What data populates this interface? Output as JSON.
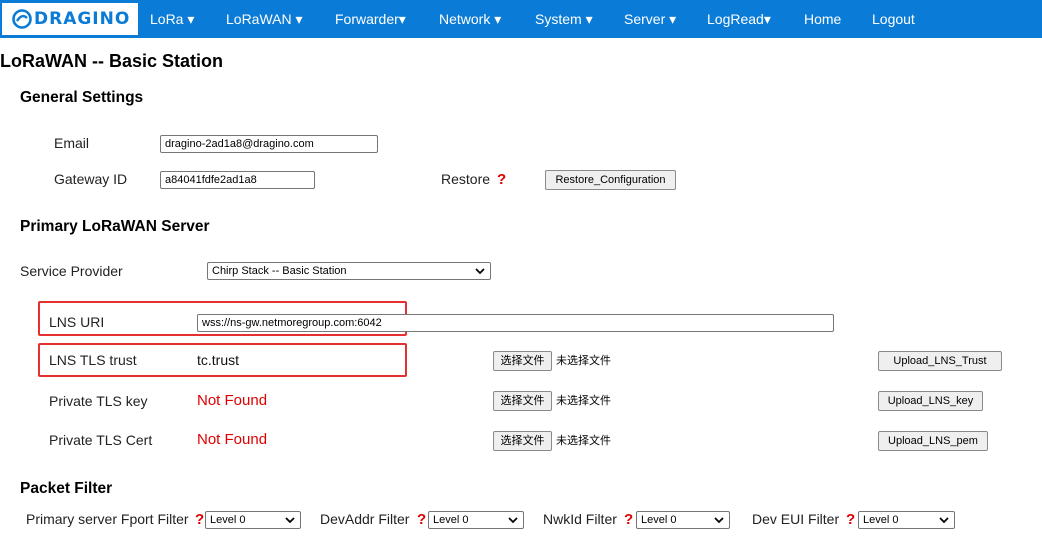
{
  "nav": {
    "brand": "DRAGINO",
    "items": [
      {
        "label": "LoRa",
        "caret": "▾"
      },
      {
        "label": "LoRaWAN",
        "caret": "▾"
      },
      {
        "label": "Forwarder",
        "caret": "▾"
      },
      {
        "label": "Network",
        "caret": "▾"
      },
      {
        "label": "System",
        "caret": "▾"
      },
      {
        "label": "Server",
        "caret": "▾"
      },
      {
        "label": "LogRead",
        "caret": "▾"
      },
      {
        "label": "Home",
        "caret": ""
      },
      {
        "label": "Logout",
        "caret": ""
      }
    ]
  },
  "page_title": "LoRaWAN -- Basic Station",
  "general": {
    "heading": "General Settings",
    "email_label": "Email",
    "email_value": "dragino-2ad1a8@dragino.com",
    "gateway_label": "Gateway ID",
    "gateway_value": "a84041fdfe2ad1a8",
    "restore_label": "Restore",
    "help_mark": "?",
    "restore_button": "Restore_Configuration"
  },
  "primary": {
    "heading": "Primary LoRaWAN Server",
    "provider_label": "Service Provider",
    "provider_value": "Chirp Stack -- Basic Station",
    "lns_uri_label": "LNS URI",
    "lns_uri_value": "wss://ns-gw.netmoregroup.com:6042",
    "tls_trust_label": "LNS TLS trust",
    "tls_trust_value": "tc.trust",
    "private_key_label": "Private TLS key",
    "private_key_value": "Not Found",
    "private_cert_label": "Private TLS Cert",
    "private_cert_value": "Not Found",
    "choose_file": "选择文件",
    "no_file": "未选择文件",
    "upload_trust": "Upload_LNS_Trust",
    "upload_key": "Upload_LNS_key",
    "upload_pem": "Upload_LNS_pem"
  },
  "packet_filter": {
    "heading": "Packet Filter",
    "fport_label": "Primary server Fport Filter",
    "devaddr_label": "DevAddr Filter",
    "nwkid_label": "NwkId Filter",
    "deveui_label": "Dev EUI Filter",
    "help_mark": "?",
    "fport_value": "Level 0",
    "devaddr_value": "Level 0",
    "nwkid_value": "Level 0",
    "deveui_value": "Level 0"
  },
  "colors": {
    "nav_bg": "#0a7bd6",
    "highlight_box": "#e53030",
    "warning_text": "#e00000"
  },
  "icons": {
    "logo": "dragino-logo-icon",
    "dropdown": "chevron-down-icon",
    "help": "question-mark-icon"
  }
}
